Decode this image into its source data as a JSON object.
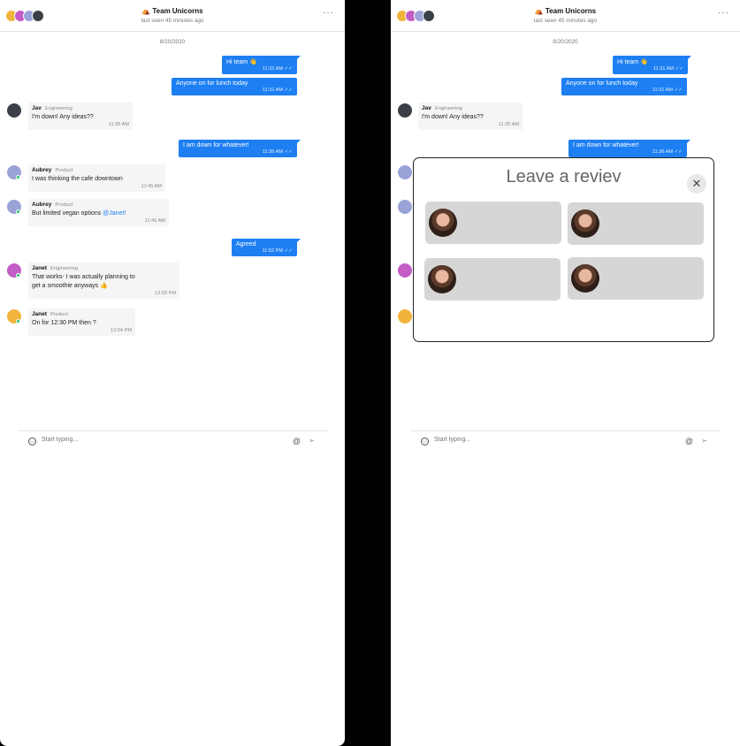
{
  "chat": {
    "title": "Team Unicorns",
    "last_seen": "last seen 45 minutes ago",
    "date": "8/20/2020",
    "menu_glyph": "···",
    "messages": [
      {
        "dir": "out",
        "text": "Hi team 👋",
        "time": "11:31 AM"
      },
      {
        "dir": "out",
        "text": "Anyone on for lunch today",
        "time": "11:31 AM"
      },
      {
        "dir": "in",
        "name": "Jav",
        "team": "Engineering",
        "text": "I'm down! Any ideas??",
        "time": "11:35 AM"
      },
      {
        "dir": "out",
        "text": "I am down for whatever!",
        "time": "11:36 AM"
      },
      {
        "dir": "in",
        "name": "Aubrey",
        "team": "Product",
        "text": "I was thinking the cafe downtown",
        "time": "11:45 AM"
      },
      {
        "dir": "in",
        "name": "Aubrey",
        "team": "Product",
        "text_prefix": "But limited vegan options ",
        "mention": "@Janet!",
        "time": "11:46 AM"
      },
      {
        "dir": "out",
        "text": "Agreed",
        "time": "11:52 PM"
      },
      {
        "dir": "in",
        "name": "Janet",
        "team": "Engineering",
        "text_line1": "That works- I was actually planning to",
        "text_line2": "get a smoothie anyways 👍",
        "time": "12:03 PM"
      },
      {
        "dir": "in",
        "name": "Janet",
        "team": "Product",
        "text": "On for 12:30 PM then ?",
        "time": "12:04 PM"
      }
    ]
  },
  "composer": {
    "placeholder": "Start typing...",
    "at_icon": "at-icon",
    "send_icon": "send-icon",
    "smile_icon": "smile-icon"
  },
  "modal": {
    "title": "Leave a reviev",
    "close_glyph": "✕"
  },
  "colors": {
    "accent": "#1d7ff2",
    "online": "#22c55e"
  }
}
